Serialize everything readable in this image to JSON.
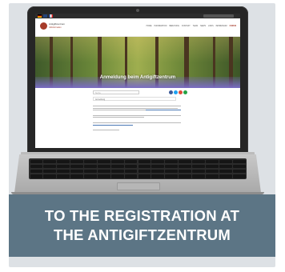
{
  "browser": {
    "flags": [
      "de",
      "en",
      "fr"
    ]
  },
  "site": {
    "logo_title": "Antigiftzentrum",
    "logo_subtitle": "Giftinformation",
    "nav": [
      "HOME",
      "INFORMATION",
      "BERATUNG",
      "KONTAKT",
      "TEAM",
      "NEWS",
      "LINKS",
      "IMPRESSUM",
      "FORUM"
    ]
  },
  "hero": {
    "title": "Anmeldung beim Antigiftzentrum"
  },
  "content": {
    "search_placeholder": "Suche",
    "tab_label": "Anmeldung",
    "share_colors": [
      "#3b5998",
      "#1da1f2",
      "#dd4b39",
      "#25a244"
    ]
  },
  "banner": {
    "line1": "TO THE REGISTRATION AT",
    "line2": "THE ANTIGIFTZENTRUM",
    "background": "#5c7585"
  }
}
